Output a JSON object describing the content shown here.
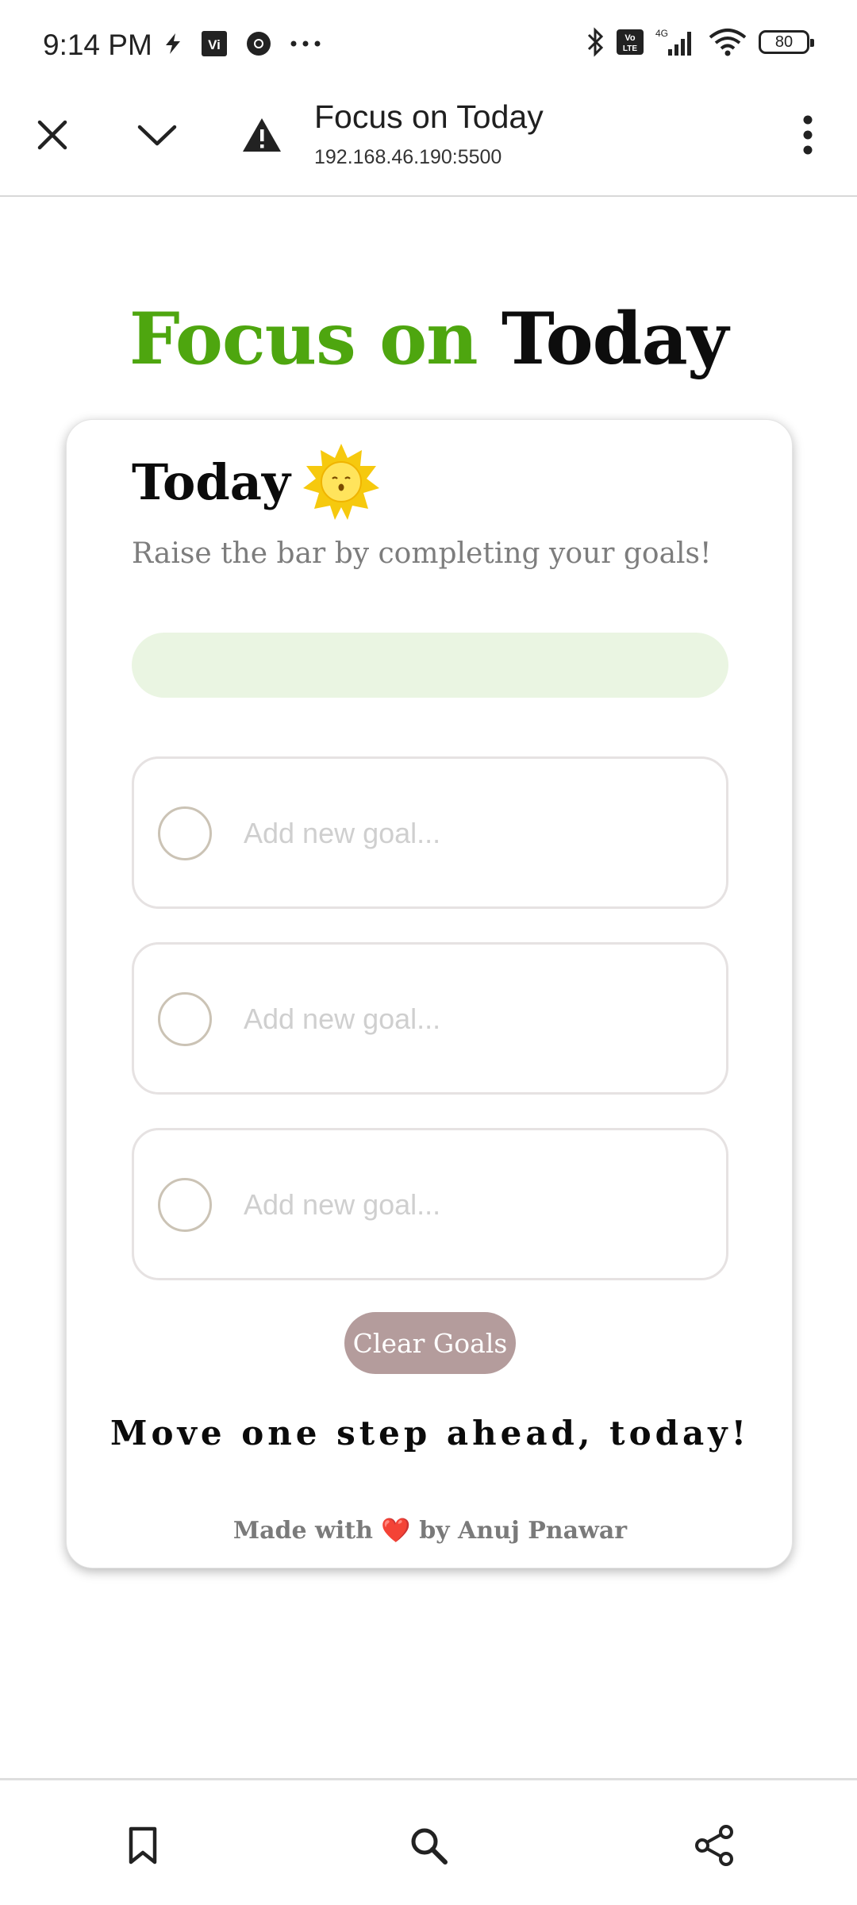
{
  "status_bar": {
    "time": "9:14 PM",
    "network": "4G",
    "battery": "80",
    "colors": {
      "icon": "#222222"
    }
  },
  "browser": {
    "title": "Focus on Today",
    "url": "192.168.46.190:5500",
    "icons": [
      "close-icon",
      "chevron-down-icon",
      "warning-icon",
      "more-vert-icon"
    ]
  },
  "page": {
    "heading_accent": "Focus on",
    "heading_rest": "Today",
    "colors": {
      "accent": "#4ea60f",
      "progress_track": "#eaf5e2",
      "clear_button": "#b49c9c"
    }
  },
  "card": {
    "title": "Today",
    "subtitle": "Raise the bar by completing your goals!",
    "progress": 0,
    "goals": [
      {
        "value": "",
        "placeholder": "Add new goal...",
        "completed": false
      },
      {
        "value": "",
        "placeholder": "Add new goal...",
        "completed": false
      },
      {
        "value": "",
        "placeholder": "Add new goal...",
        "completed": false
      }
    ],
    "clear_label": "Clear Goals",
    "quote": "Move one step ahead, today!",
    "credit_prefix": "Made with",
    "credit_heart": "❤️",
    "credit_suffix": "by Anuj Pnawar"
  },
  "bottom_bar": {
    "icons": [
      "bookmark-icon",
      "search-icon",
      "share-icon"
    ]
  }
}
